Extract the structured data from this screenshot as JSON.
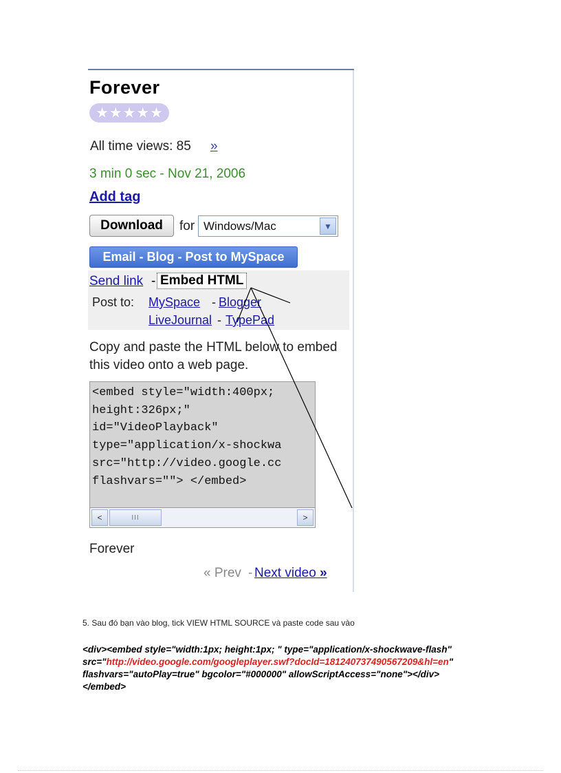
{
  "video": {
    "title": "Forever",
    "stars": "★★★★★",
    "views": "All time views: 85",
    "more_arrow": "»",
    "date_line": "3 min 0 sec - Nov 21, 2006",
    "add_tag": "Add tag",
    "download_label": "Download",
    "for_label": "for",
    "os_select": "Windows/Mac",
    "share_bar": "Email - Blog - Post to MySpace"
  },
  "share": {
    "send_link": "Send link",
    "dash": "-",
    "embed_html": "Embed HTML",
    "post_to": "Post to:",
    "myspace": "MySpace",
    "blogger": "Blogger",
    "livejournal": "LiveJournal",
    "typepad": "TypePad"
  },
  "embed": {
    "instructions": "Copy and paste the HTML below to embed this video onto a web page.",
    "code": "<embed style=\"width:400px;\nheight:326px;\"\nid=\"VideoPlayback\"\ntype=\"application/x-shockwa\nsrc=\"http://video.google.cc\nflashvars=\"\"> </embed>",
    "scroll_left": "<",
    "scroll_right": ">",
    "thumb_grip": "III"
  },
  "footer": {
    "title": "Forever",
    "prev": "« Prev",
    "sep": "-",
    "next": "Next video",
    "next_arrows": "»"
  },
  "doc": {
    "step": "5. Sau đó bạn vào blog, tick VIEW HTML SOURCE và paste code sau vào",
    "code_part1": "<div><embed style=\"width:1px;  height:1px;  \" type=\"application/x-shockwave-flash\" src=\"",
    "code_url": "http://video.google.com/googleplayer.swf?docId=181240737490567209&hl=en",
    "code_part2": "\" flashvars=\"autoPlay=true\" bgcolor=\"#000000\"  allowScriptAccess=\"none\"></div></embed>"
  },
  "colors": {
    "link": "#1a1aa6",
    "date_green": "#3a8f2c",
    "share_blue": "#3f6fcd",
    "url_red": "#e02020"
  }
}
